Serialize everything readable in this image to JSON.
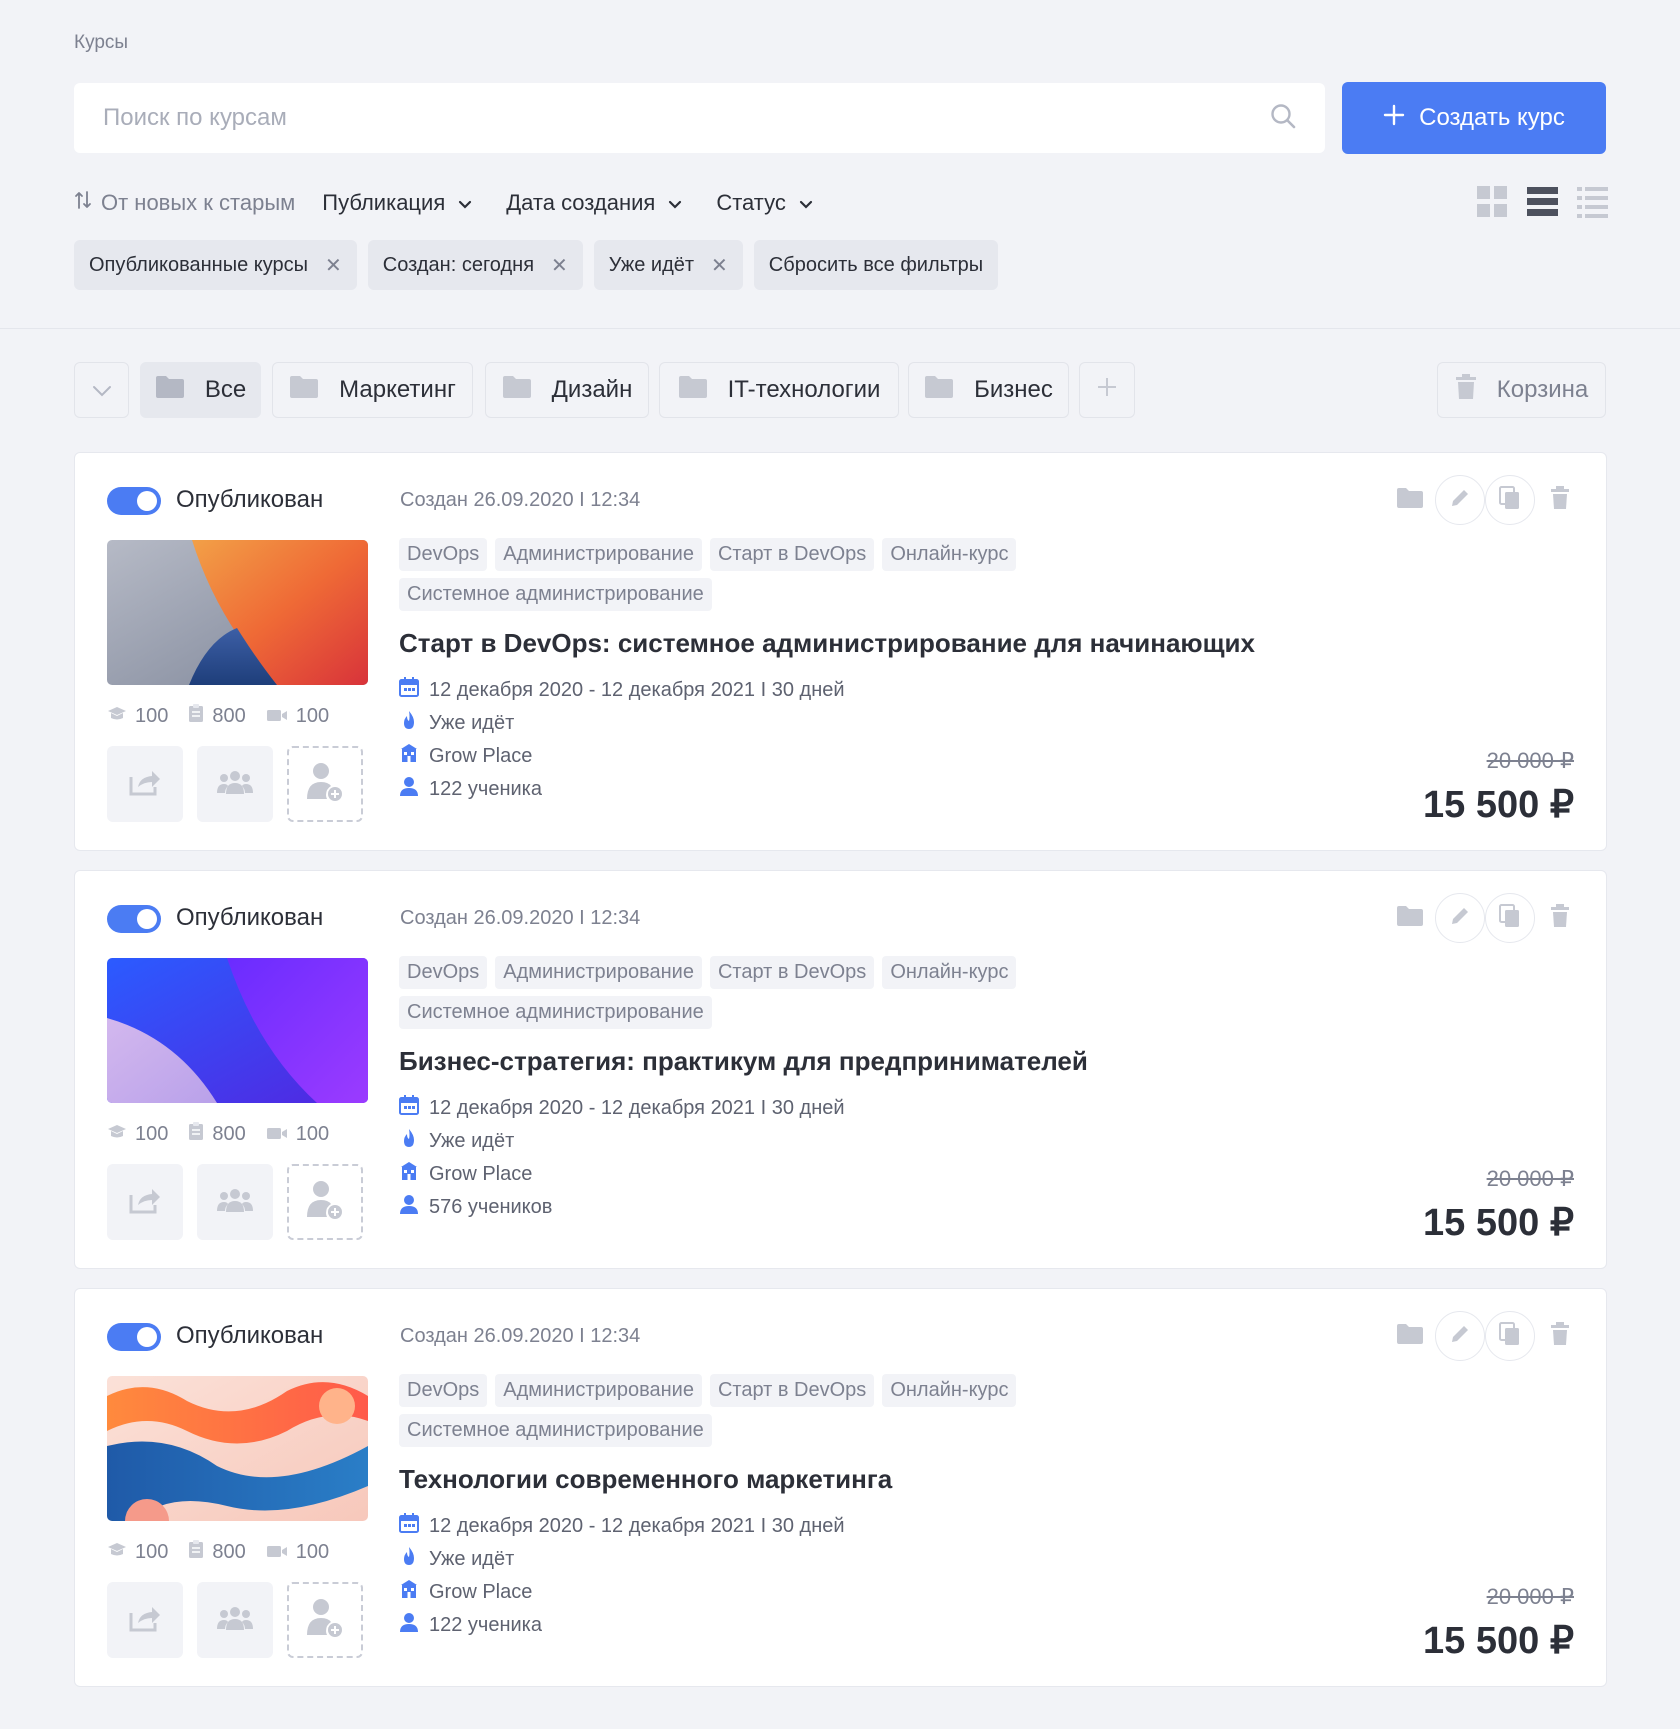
{
  "page": {
    "title": "Курсы"
  },
  "search": {
    "placeholder": "Поиск по курсам"
  },
  "create_button": {
    "label": "Создать курс"
  },
  "filters": {
    "sort_label": "От новых к старым",
    "dropdowns": [
      "Публикация",
      "Дата создания",
      "Статус"
    ]
  },
  "view_modes": [
    "grid-view-icon",
    "list-view-icon",
    "compact-list-icon"
  ],
  "active_filters": [
    "Опубликованные курсы",
    "Создан: сегодня",
    "Уже идёт"
  ],
  "reset_filters_label": "Сбросить все фильтры",
  "folders": [
    "Все",
    "Маркетинг",
    "Дизайн",
    "IT-технологии",
    "Бизнес"
  ],
  "trash_label": "Корзина",
  "courses": [
    {
      "status": "Опубликован",
      "created": "Создан 26.09.2020 I 12:34",
      "tags": [
        "DevOps",
        "Администрирование",
        "Старт в DevOps",
        "Онлайн-курс",
        "Системное администрирование"
      ],
      "title": "Старт в DevOps: системное администрирование для начинающих",
      "dates": "12 декабря 2020 - 12 декабря 2021  I  30 дней",
      "progress": "Уже идёт",
      "school": "Grow Place",
      "students": "122 ученика",
      "stats": [
        "100",
        "800",
        "100"
      ],
      "old_price": "20 000 ₽",
      "price": "15 500 ₽"
    },
    {
      "status": "Опубликован",
      "created": "Создан 26.09.2020 I 12:34",
      "tags": [
        "DevOps",
        "Администрирование",
        "Старт в DevOps",
        "Онлайн-курс",
        "Системное администрирование"
      ],
      "title": "Бизнес-стратегия: практикум для предпринимателей",
      "dates": "12 декабря 2020 - 12 декабря 2021  I  30 дней",
      "progress": "Уже идёт",
      "school": "Grow Place",
      "students": "576 учеников",
      "stats": [
        "100",
        "800",
        "100"
      ],
      "old_price": "20 000 ₽",
      "price": "15 500 ₽"
    },
    {
      "status": "Опубликован",
      "created": "Создан 26.09.2020 I 12:34",
      "tags": [
        "DevOps",
        "Администрирование",
        "Старт в DevOps",
        "Онлайн-курс",
        "Системное администрирование"
      ],
      "title": "Технологии современного маркетинга",
      "dates": "12 декабря 2020 - 12 декабря 2021  I  30 дней",
      "progress": "Уже идёт",
      "school": "Grow Place",
      "students": "122 ученика",
      "stats": [
        "100",
        "800",
        "100"
      ],
      "old_price": "20 000 ₽",
      "price": "15 500 ₽"
    }
  ],
  "colors": {
    "accent": "#4b7cf3",
    "background": "#f2f3f7",
    "text": "#2c2f38",
    "muted": "#7d8190"
  }
}
